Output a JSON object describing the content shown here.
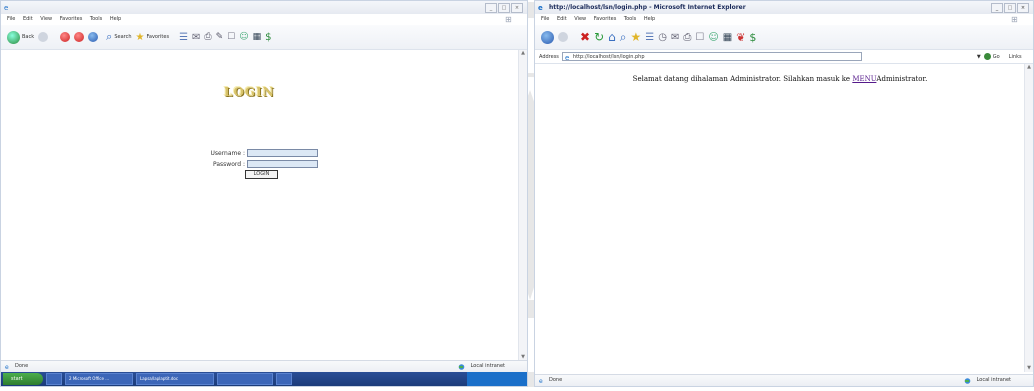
{
  "left_window": {
    "menu": [
      "File",
      "Edit",
      "View",
      "Favorites",
      "Tools",
      "Help"
    ],
    "toolbar": {
      "back_label": "Back",
      "search_label": "Search",
      "favorites_label": "Favorites"
    },
    "login": {
      "logo_text": "LOGIN",
      "username_label": "Username :",
      "password_label": "Password :",
      "username_value": "",
      "password_value": "",
      "button_label": "LOGIN"
    },
    "status": {
      "left": "Done",
      "right": "Local intranet"
    },
    "taskbar": {
      "start": "start",
      "tasks": [
        "",
        "2 Microsoft Office ...",
        "Lapsa/Iaplaptit.doc",
        "",
        ""
      ],
      "tray_time": ""
    }
  },
  "right_window": {
    "title": "http://localhost/lsn/login.php - Microsoft Internet Explorer",
    "menu": [
      "File",
      "Edit",
      "View",
      "Favorites",
      "Tools",
      "Help"
    ],
    "address_label": "Address",
    "address_value": "http://localhost/lsn/login.php",
    "go_label": "Go",
    "links_label": "Links",
    "welcome": {
      "before": "Selamat datang dihalaman Administrator. Silahkan masuk ke ",
      "link": "MENU",
      "after": "Administrator."
    },
    "status": {
      "left": "Done",
      "right": "Local intranet"
    }
  },
  "colors": {
    "accent": "#2a4e96",
    "logo": "#d8c36a",
    "link": "#551a8b",
    "input_bg": "#dce8f5"
  }
}
